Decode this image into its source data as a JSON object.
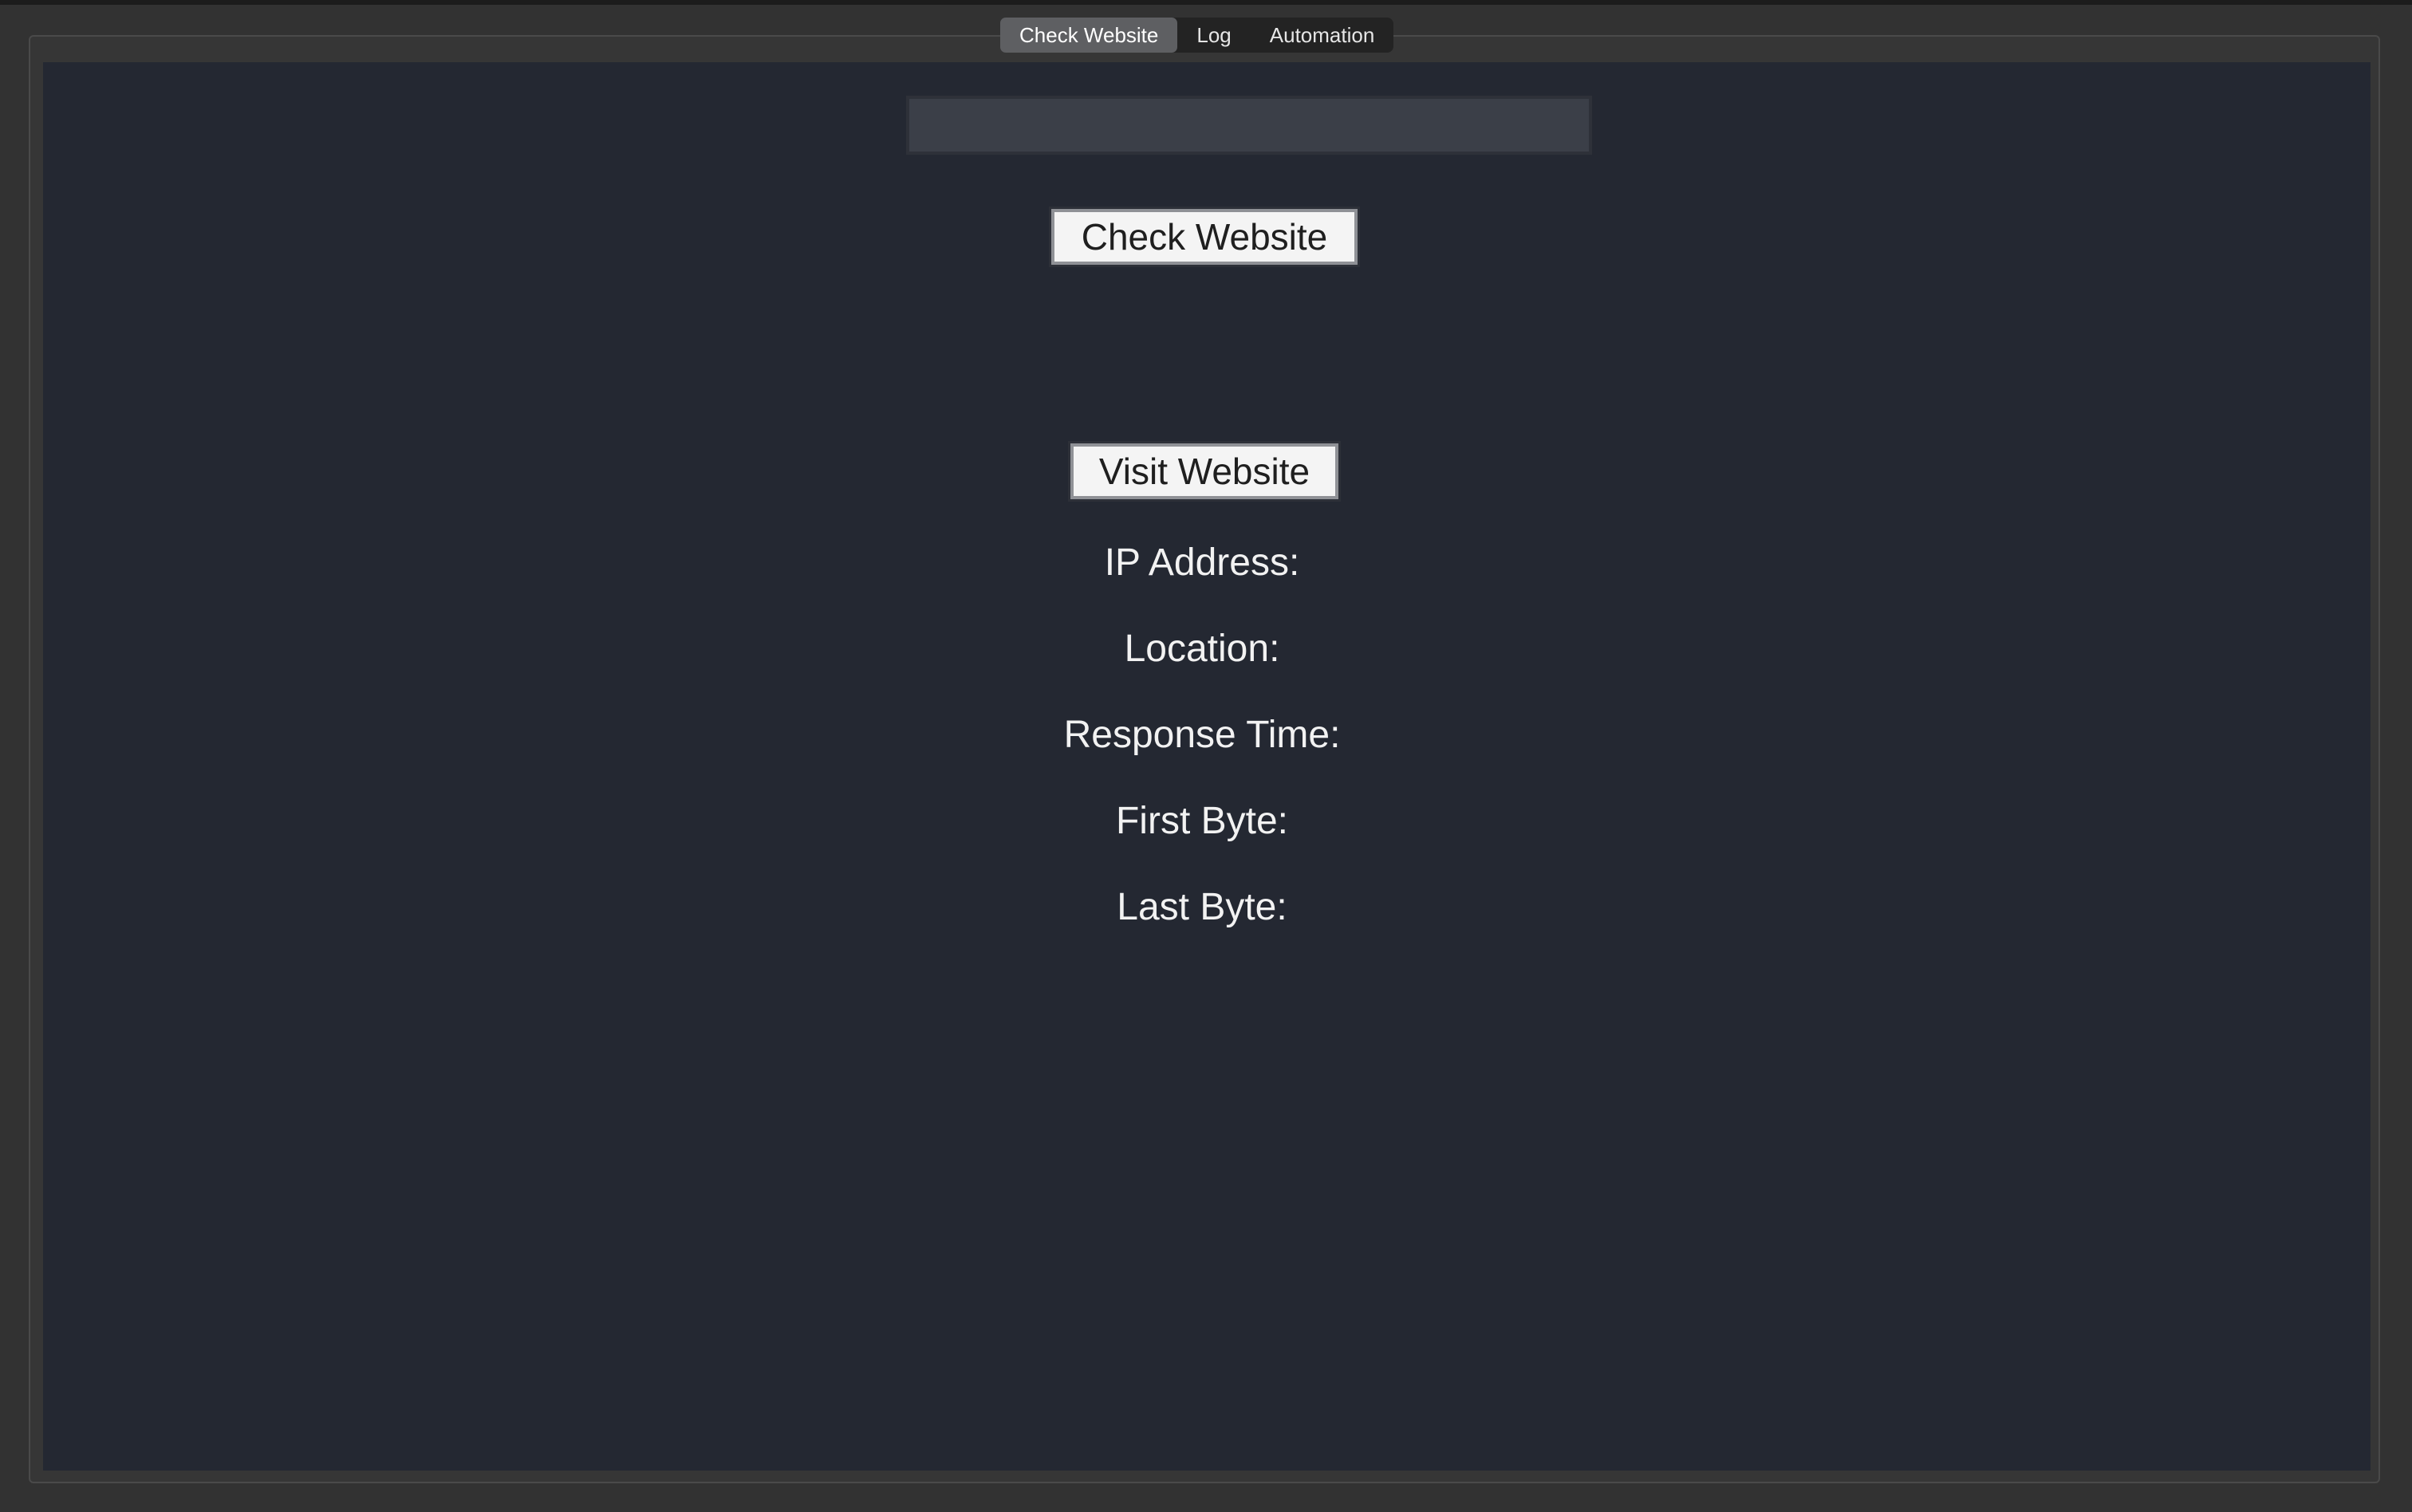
{
  "tabs": [
    {
      "label": "Check Website",
      "active": true
    },
    {
      "label": "Log",
      "active": false
    },
    {
      "label": "Automation",
      "active": false
    }
  ],
  "form": {
    "url_value": "",
    "url_placeholder": "",
    "check_button_label": "Check Website",
    "visit_button_label": "Visit Website"
  },
  "results": {
    "ip_label": "IP Address:",
    "location_label": "Location:",
    "response_time_label": "Response Time:",
    "first_byte_label": "First Byte:",
    "last_byte_label": "Last Byte:"
  },
  "colors": {
    "window_bg": "#323232",
    "content_bg": "#242832",
    "active_tab": "#5e5f62",
    "input_bg": "#3b3f48",
    "button_bg": "#f4f4f4"
  }
}
